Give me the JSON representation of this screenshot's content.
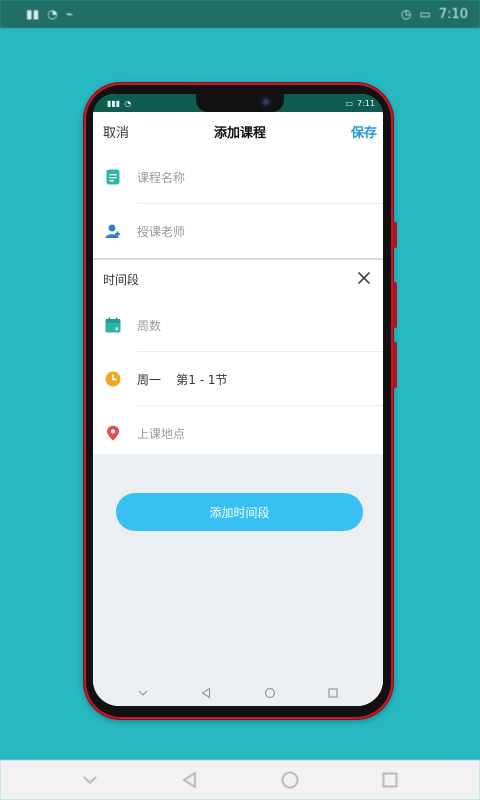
{
  "outer_status": {
    "time": "7:10"
  },
  "phone_status": {
    "time": "7:11"
  },
  "header": {
    "cancel_label": "取消",
    "title": "添加课程",
    "save_label": "保存"
  },
  "fields": {
    "course_name_placeholder": "课程名称",
    "teacher_placeholder": "授课老师"
  },
  "time_section": {
    "label": "时间段",
    "weeks_placeholder": "周数",
    "day_period_value": "周一    第1 - 1节",
    "location_placeholder": "上课地点"
  },
  "add_time_button_label": "添加时间段",
  "colors": {
    "background": "#27b8c1",
    "accent": "#1f9bd8",
    "button": "#36c1f2",
    "icon_teal": "#2bb7a8",
    "icon_blue": "#2f7fd1",
    "icon_orange": "#f2a81d",
    "icon_red": "#e84b4b",
    "phone_frame": "#c8182a"
  },
  "icons": [
    "document-icon",
    "teacher-icon",
    "calendar-icon",
    "clock-icon",
    "location-pin-icon",
    "close-icon",
    "back-icon",
    "home-icon",
    "recents-icon"
  ]
}
